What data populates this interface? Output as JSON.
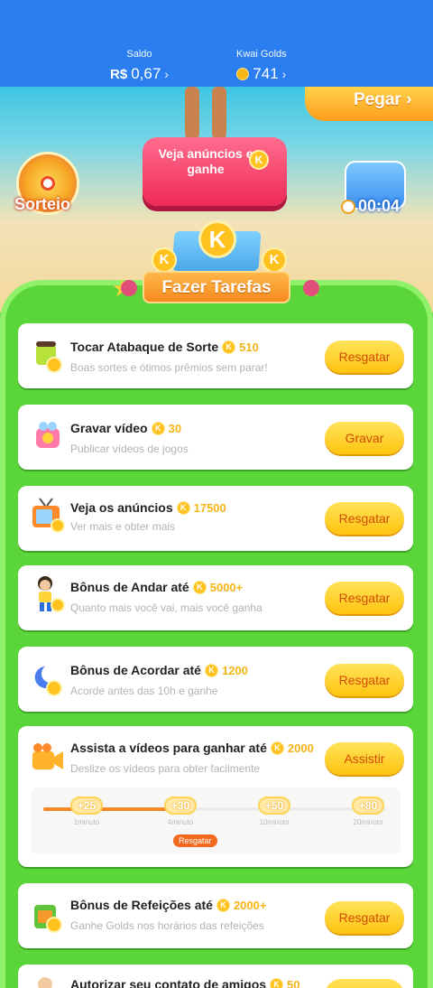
{
  "header": {
    "saldo_label": "Saldo",
    "saldo_currency": "R$",
    "saldo_value": "0,67",
    "golds_label": "Kwai Golds",
    "golds_value": "741",
    "chevron": "›"
  },
  "hero": {
    "pegar_label": "Pegar ›",
    "sorteio_label": "Sorteio",
    "ads_button": "Veja anúncios e ganhe",
    "timer": "00:04"
  },
  "banner": {
    "title": "Fazer Tarefas",
    "coin_letter": "K"
  },
  "tasks": [
    {
      "title": "Tocar Atabaque de Sorte",
      "points": "510",
      "subtitle": "Boas sortes e ótimos prêmios sem parar!",
      "button": "Resgatar",
      "icon": "drum-icon"
    },
    {
      "title": "Gravar vídeo",
      "points": "30",
      "subtitle": "Publicar vídeos de jogos",
      "button": "Gravar",
      "icon": "camera-icon"
    },
    {
      "title": "Veja os anúncios",
      "points": "17500",
      "subtitle": "Ver mais e obter mais",
      "button": "Resgatar",
      "icon": "tv-icon"
    },
    {
      "title": "Bônus de Andar até",
      "points": "5000+",
      "subtitle": "Quanto mais você vai, mais você ganha",
      "button": "Resgatar",
      "icon": "walker-icon"
    },
    {
      "title": "Bônus de Acordar até",
      "points": "1200",
      "subtitle": "Acorde antes das 10h e ganhe",
      "button": "Resgatar",
      "icon": "moon-icon"
    },
    {
      "title": "Assista a vídeos para ganhar até",
      "points": "2000",
      "subtitle": "Deslize os vídeos para obter facilmente",
      "button": "Assistir",
      "icon": "video-camera-icon"
    },
    {
      "title": "Bônus de Refeições até",
      "points": "2000+",
      "subtitle": "Ganhe Golds nos horários das refeições",
      "button": "Resgatar",
      "icon": "meal-icon"
    },
    {
      "title": "Autorizar seu contato de amigos",
      "points": "50",
      "subtitle": "",
      "button": "",
      "icon": "contacts-icon"
    }
  ],
  "progress": {
    "fill_fraction": 0.37,
    "nodes": [
      {
        "reward": "+25",
        "time": "1minuto"
      },
      {
        "reward": "+30",
        "time": "4minuto"
      },
      {
        "reward": "+50",
        "time": "10minuto"
      },
      {
        "reward": "+80",
        "time": "20minuto"
      }
    ],
    "claim_label": "Resgatar"
  },
  "colors": {
    "header_blue": "#2a7ef0",
    "panel_green": "#5ad63a",
    "button_yellow": "#ffc40f",
    "points_gold": "#f5b416"
  }
}
